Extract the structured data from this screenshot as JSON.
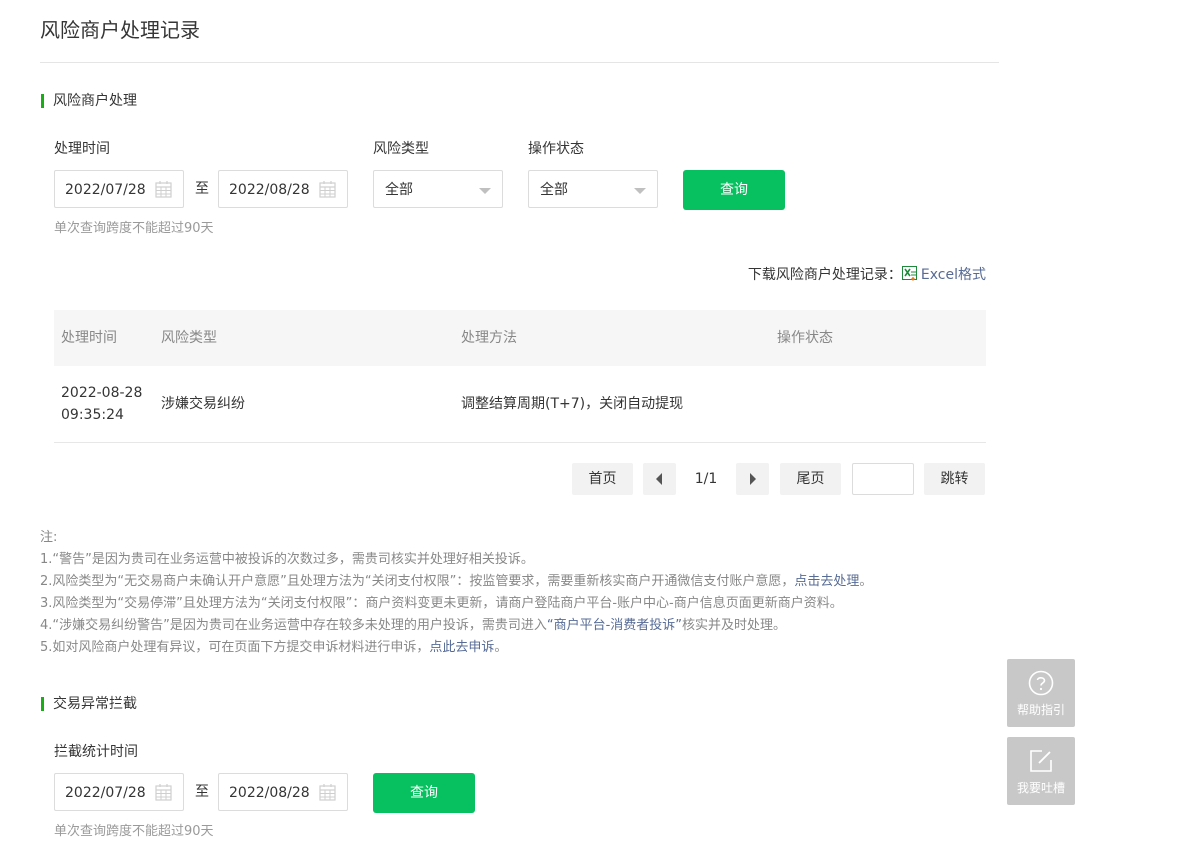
{
  "page": {
    "title": "风险商户处理记录"
  },
  "section1": {
    "title": "风险商户处理",
    "time_label": "处理时间",
    "start_date": "2022/07/28",
    "separator": "至",
    "end_date": "2022/08/28",
    "risk_type_label": "风险类型",
    "risk_type_value": "全部",
    "status_label": "操作状态",
    "status_value": "全部",
    "query_button": "查询",
    "hint": "单次查询跨度不能超过90天",
    "download_label": "下载风险商户处理记录：",
    "download_link": "Excel格式"
  },
  "table": {
    "headers": [
      "处理时间",
      "风险类型",
      "处理方法",
      "操作状态"
    ],
    "rows": [
      {
        "time": "2022-08-28 09:35:24",
        "type": "涉嫌交易纠纷",
        "method": "调整结算周期(T+7)，关闭自动提现",
        "status": ""
      }
    ]
  },
  "pagination": {
    "first": "首页",
    "page_info": "1/1",
    "last": "尾页",
    "jump": "跳转",
    "page_input": ""
  },
  "notes": {
    "heading": "注:",
    "line1": "1.“警告”是因为贵司在业务运营中被投诉的次数过多，需贵司核实并处理好相关投诉。",
    "line2_text": "2.风险类型为“无交易商户未确认开户意愿”且处理方法为“关闭支付权限”：按监管要求，需要重新核实商户开通微信支付账户意愿，",
    "line2_link": "点击去处理",
    "line2_end": "。",
    "line3": "3.风险类型为“交易停滞”且处理方法为“关闭支付权限”：商户资料变更未更新，请商户登陆商户平台-账户中心-商户信息页面更新商户资料。",
    "line4_text": "4.“涉嫌交易纠纷警告”是因为贵司在业务运营中存在较多未处理的用户投诉，需贵司进入",
    "line4_link": "“商户平台-消费者投诉”",
    "line4_end": "核实并及时处理。",
    "line5_text": "5.如对风险商户处理有异议，可在页面下方提交申诉材料进行申诉，",
    "line5_link": "点此去申诉",
    "line5_end": "。"
  },
  "section2": {
    "title": "交易异常拦截",
    "time_label": "拦截统计时间",
    "start_date": "2022/07/28",
    "separator": "至",
    "end_date": "2022/08/28",
    "query_button": "查询",
    "hint": "单次查询跨度不能超过90天"
  },
  "floating": {
    "help_label": "帮助指引",
    "feedback_label": "我要吐槽"
  },
  "icons": {
    "calendar": "calendar-icon",
    "excel": "excel-icon",
    "help": "question-circle-icon",
    "feedback": "edit-icon"
  },
  "colors": {
    "primary_green": "#07c160",
    "accent_bar": "#1aad19",
    "link_blue": "#576b95"
  }
}
